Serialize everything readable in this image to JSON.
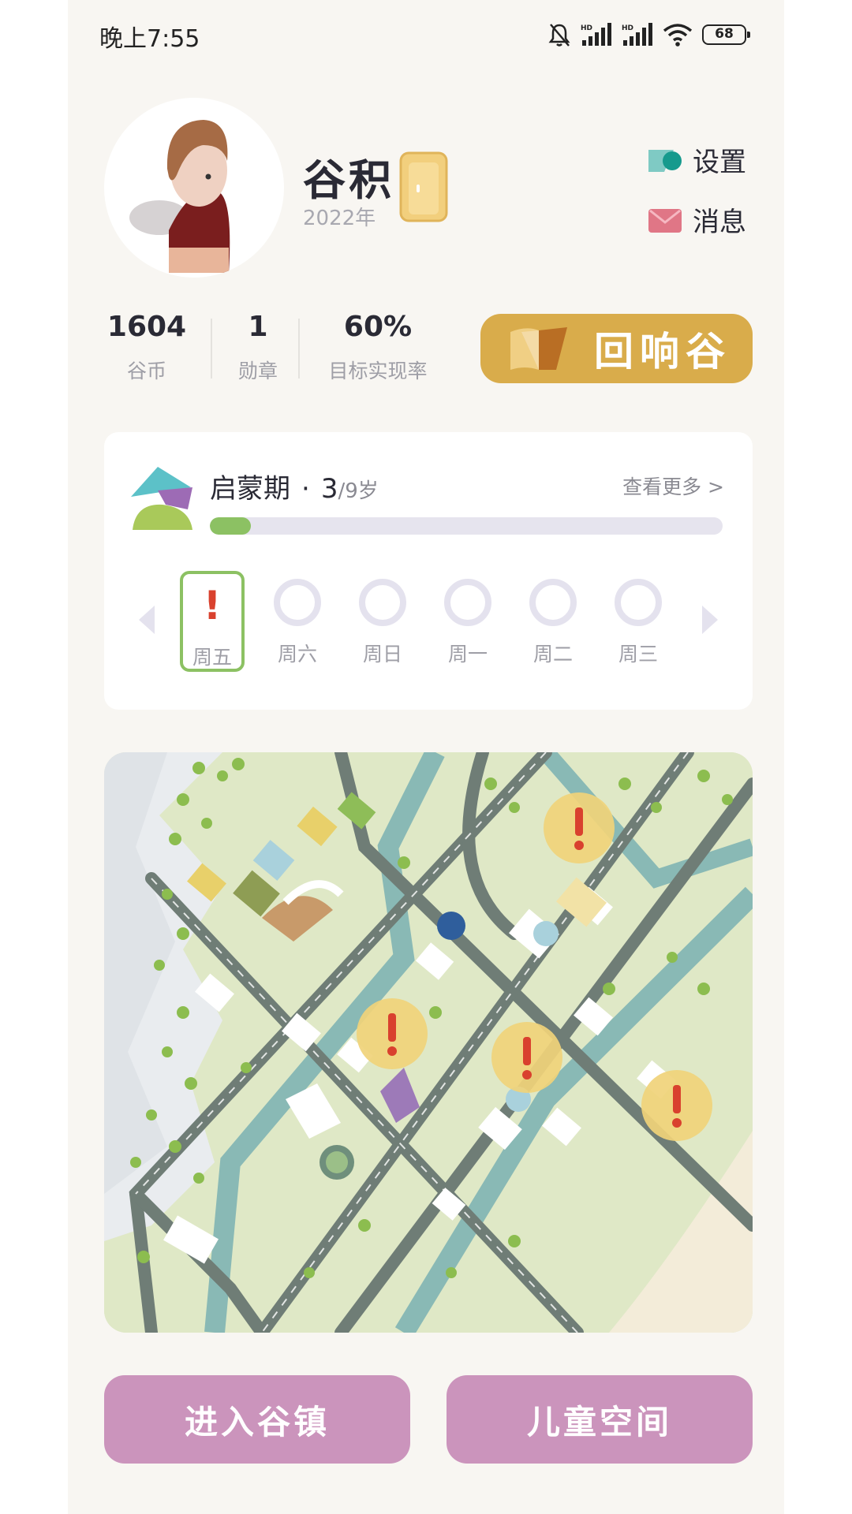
{
  "status_bar": {
    "time": "晚上7:55",
    "battery": "68"
  },
  "profile": {
    "name": "谷积",
    "year": "2022年"
  },
  "links": {
    "settings": "设置",
    "messages": "消息"
  },
  "stats": [
    {
      "value": "1604",
      "label": "谷币"
    },
    {
      "value": "1",
      "label": "勋章"
    },
    {
      "value": "60%",
      "label": "目标实现率"
    }
  ],
  "echo_button": {
    "label": "回响谷"
  },
  "stage": {
    "title": "启蒙期",
    "separator": "·",
    "age": "3",
    "age_total": "/9岁",
    "see_more": "查看更多 >",
    "progress": 0.08
  },
  "days": [
    {
      "label": "周五",
      "status": "alert"
    },
    {
      "label": "周六",
      "status": "empty"
    },
    {
      "label": "周日",
      "status": "empty"
    },
    {
      "label": "周一",
      "status": "empty"
    },
    {
      "label": "周二",
      "status": "empty"
    },
    {
      "label": "周三",
      "status": "empty"
    }
  ],
  "alert_mark": "!",
  "buttons": {
    "enter_town": "进入谷镇",
    "kids_space": "儿童空间"
  },
  "colors": {
    "accent_gold": "#d9ac4b",
    "button_pink": "#cb94bc",
    "progress_green": "#8cc163",
    "alert_red": "#d9412e",
    "marker_yellow": "#f0d37a"
  },
  "icons": [
    "muted-bell-icon",
    "signal-icon",
    "wifi-icon",
    "battery-icon",
    "settings-icon",
    "message-icon",
    "door-icon",
    "echo-icon",
    "stage-logo-icon",
    "chevron-left-icon",
    "chevron-right-icon",
    "alert-marker-icon"
  ]
}
